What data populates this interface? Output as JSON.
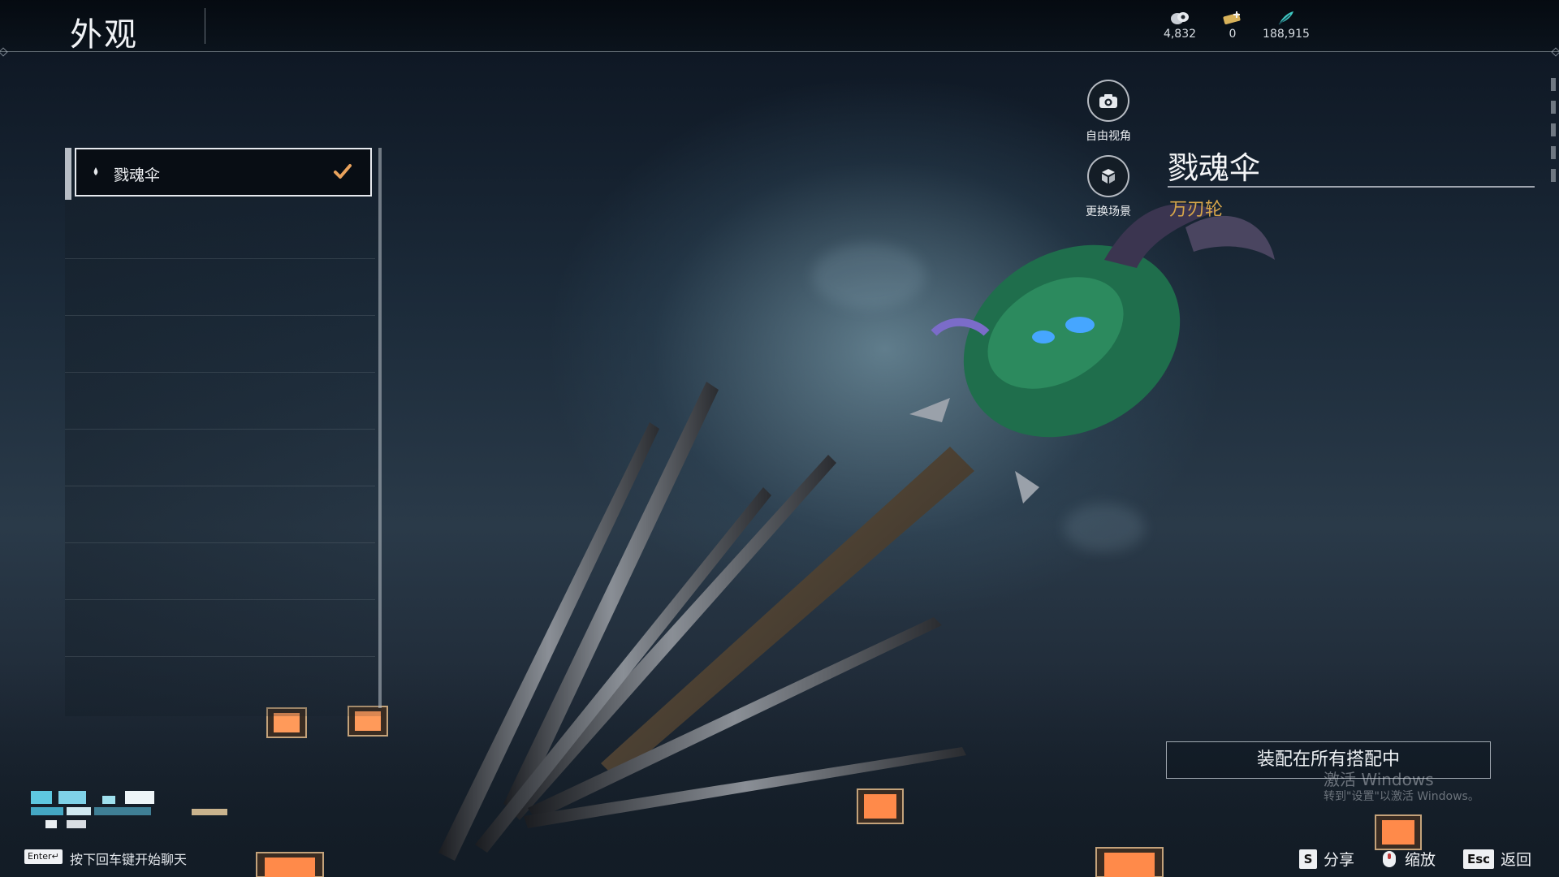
{
  "header": {
    "title": "外观",
    "currencies": [
      {
        "icon": "coin-pouch-icon",
        "value": "4,832"
      },
      {
        "icon": "ticket-plus-icon",
        "value": "0"
      },
      {
        "icon": "feather-icon",
        "value": "188,915"
      }
    ]
  },
  "side_actions": {
    "free_camera": "自由视角",
    "change_scene": "更换场景"
  },
  "item": {
    "name": "戮魂伞",
    "category": "万刃轮"
  },
  "list": {
    "items": [
      {
        "label": "戮魂伞",
        "selected": true
      }
    ]
  },
  "equip_button": "装配在所有搭配中",
  "watermark": {
    "line1": "激活 Windows",
    "line2": "转到\"设置\"以激活 Windows。"
  },
  "chat": {
    "key": "Enter↵",
    "hint": "按下回车键开始聊天"
  },
  "footer": {
    "share_key": "S",
    "share_label": "分享",
    "zoom_label": "缩放",
    "back_key": "Esc",
    "back_label": "返回"
  },
  "colors": {
    "accent_gold": "#d7a64a",
    "check_orange": "#e9a25c"
  }
}
